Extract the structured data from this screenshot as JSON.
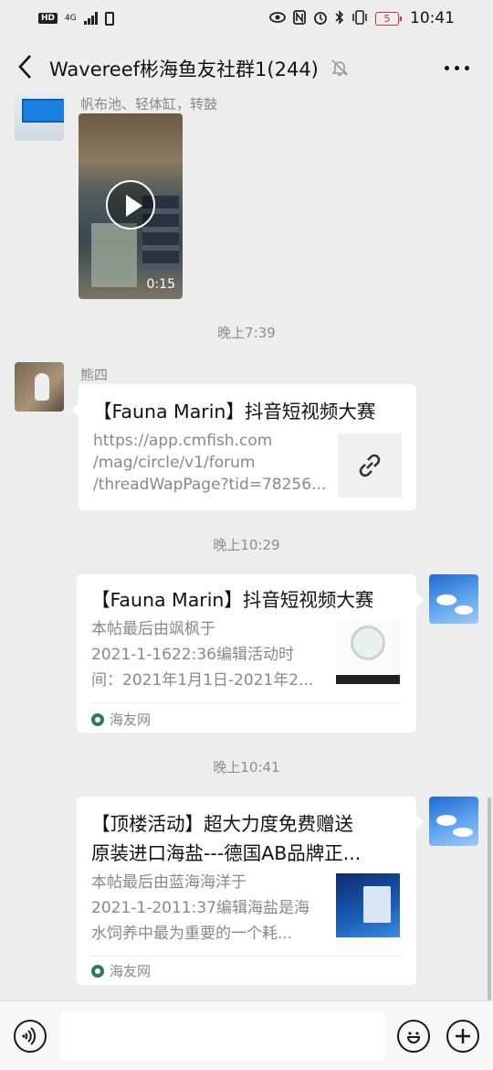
{
  "status_bar": {
    "hd": "HD",
    "network": "4G",
    "battery_level": "5",
    "time": "10:41"
  },
  "header": {
    "title": "Wavereef彬海鱼友社群1(244)"
  },
  "messages": {
    "pool_caption": "帆布池、轻体缸，转鼓",
    "video_duration": "0:15",
    "ts1": "晚上7:39",
    "xiongsi_name": "熊四",
    "card1": {
      "title": "【Fauna Marin】抖音短视频大赛",
      "desc": [
        "https://app.cmfish.com",
        "/mag/circle/v1/forum",
        "/threadWapPage?tid=78256..."
      ]
    },
    "ts2": "晚上10:29",
    "card2": {
      "title": "【Fauna Marin】抖音短视频大赛",
      "desc": [
        "本帖最后由飒枫于",
        "2021-1-1622:36编辑活动时",
        "间：2021年1月1日-2021年2..."
      ],
      "source": "海友网"
    },
    "ts3": "晚上10:41",
    "card3": {
      "title": [
        "【顶楼活动】超大力度免费赠送",
        "原装进口海盐---德国AB品牌正..."
      ],
      "desc": [
        "本帖最后由蓝海海洋于",
        "2021-1-2011:37编辑海盐是海",
        "水饲养中最为重要的一个耗..."
      ],
      "source": "海友网"
    }
  },
  "input": {
    "placeholder": ""
  },
  "colors": {
    "background": "#ededed",
    "card": "#ffffff",
    "muted_text": "#888888",
    "input_bar": "#f7f7f7"
  },
  "icons": {
    "back": "chevron-left-icon",
    "mute": "bell-off-icon",
    "more": "more-dots-icon",
    "voice": "voice-icon",
    "emoji": "emoji-icon",
    "add": "plus-icon",
    "link": "link-icon",
    "play": "play-icon"
  }
}
